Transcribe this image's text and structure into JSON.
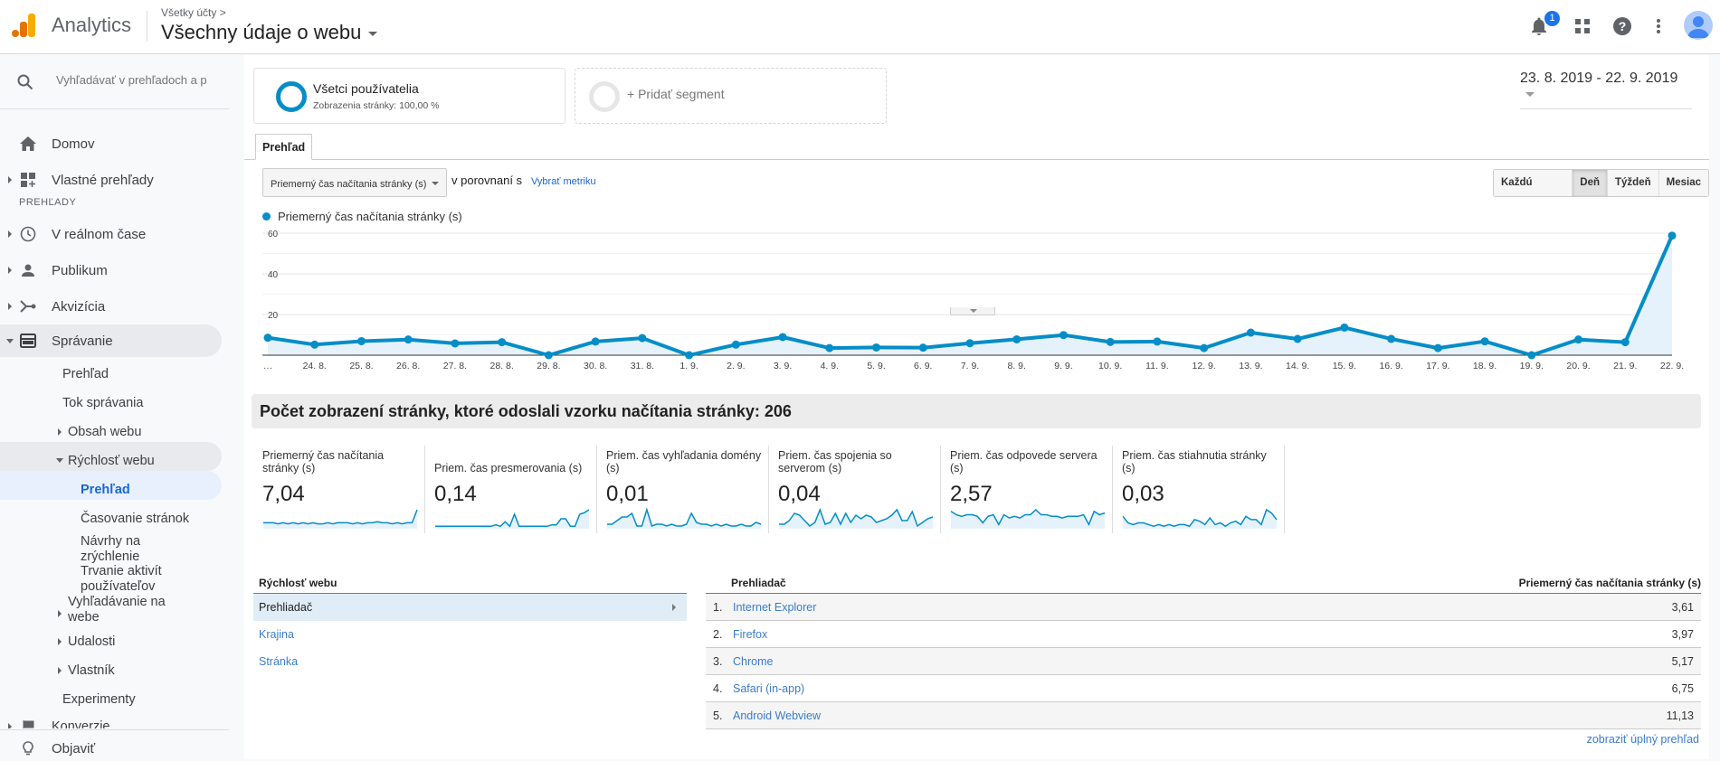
{
  "header": {
    "app_name": "Analytics",
    "breadcrumb": "Všetky účty >",
    "property": "Všechny údaje o webu",
    "notification_count": "1",
    "icons": [
      "bell-icon",
      "apps-grid-icon",
      "help-icon",
      "more-vert-icon",
      "account-avatar"
    ]
  },
  "sidebar": {
    "search_placeholder": "Vyhľadávať v prehľadoch a p",
    "items": [
      {
        "label": "Domov",
        "icon": "home-icon"
      },
      {
        "label": "Vlastné prehľady",
        "icon": "dashboard-add-icon"
      }
    ],
    "section_label": "PREHĽADY",
    "reports": [
      {
        "label": "V reálnom čase",
        "icon": "clock-icon"
      },
      {
        "label": "Publikum",
        "icon": "person-icon"
      },
      {
        "label": "Akvizícia",
        "icon": "acquisition-icon"
      },
      {
        "label": "Správanie",
        "icon": "behavior-icon"
      }
    ],
    "behavior_sub": {
      "overview": "Prehľad",
      "flow": "Tok správania",
      "content": "Obsah webu",
      "speed": "Rýchlosť webu",
      "speed_sub": [
        "Prehľad",
        "Časovanie stránok",
        "Návrhy na zrýchlenie"
      ],
      "user_timings": "Trvanie aktivít používateľov",
      "site_search": "Vyhľadávanie na webe",
      "events": "Udalosti",
      "publisher": "Vlastník",
      "experiments": "Experimenty"
    },
    "conversions": "Konverzie",
    "discover": "Objaviť"
  },
  "segments": {
    "active": {
      "title": "Všetci používatelia",
      "subtitle": "Zobrazenia stránky: 100,00 %"
    },
    "add_label": "+ Pridať segment"
  },
  "date_range": "23. 8. 2019 - 22. 9. 2019",
  "tabs": [
    "Prehľad"
  ],
  "controls": {
    "metric": "Priemerný čas načítania stránky (s)",
    "compare_text": "v porovnaní s",
    "compare_link": "Vybrať metriku",
    "granularity": [
      "Každú hodinu",
      "Deň",
      "Týždeň",
      "Mesiac"
    ],
    "active_granularity": "Deň"
  },
  "chart_data": {
    "type": "area",
    "title": "",
    "legend": [
      "Priemerný čas načítania stránky (s)"
    ],
    "series_color": "#058dc7",
    "x": [
      "…",
      "24. 8.",
      "25. 8.",
      "26. 8.",
      "27. 8.",
      "28. 8.",
      "29. 8.",
      "30. 8.",
      "31. 8.",
      "1. 9.",
      "2. 9.",
      "3. 9.",
      "4. 9.",
      "5. 9.",
      "6. 9.",
      "7. 9.",
      "8. 9.",
      "9. 9.",
      "10. 9.",
      "11. 9.",
      "12. 9.",
      "13. 9.",
      "14. 9.",
      "15. 9.",
      "16. 9.",
      "17. 9.",
      "18. 9.",
      "19. 9.",
      "20. 9.",
      "21. 9.",
      "22. 9."
    ],
    "series": [
      {
        "name": "Priemerný čas načítania stránky (s)",
        "values": [
          8.6,
          5.2,
          6.9,
          7.7,
          5.8,
          6.4,
          0,
          6.7,
          8.4,
          0,
          5.2,
          8.9,
          3.5,
          3.8,
          3.7,
          5.9,
          7.8,
          9.9,
          6.5,
          6.7,
          3.5,
          11.1,
          8.0,
          13.6,
          8.0,
          3.5,
          6.8,
          0,
          7.7,
          6.4,
          58.8
        ]
      }
    ],
    "yticks": [
      20,
      40,
      60
    ],
    "ylim": [
      0,
      60
    ],
    "grid": true,
    "legend_position": "top-left"
  },
  "summary": "Počet zobrazení stránky, ktoré odoslali vzorku načítania stránky: 206",
  "scorecards": [
    {
      "label": "Priemerný čas načítania stránky (s)",
      "value": "7,04",
      "spark": [
        5,
        5,
        5,
        4,
        5,
        4,
        5,
        4,
        5,
        4,
        5,
        4,
        4,
        5,
        4,
        5,
        5,
        5,
        4,
        5,
        4,
        5,
        5,
        6,
        5,
        5,
        4,
        5,
        4,
        5,
        5,
        18
      ]
    },
    {
      "label": "Priem. čas presmerovania (s)",
      "value": "0,14",
      "spark": [
        1,
        1,
        1,
        1,
        1,
        1,
        1,
        1,
        1,
        1,
        1,
        1,
        1,
        2,
        1,
        4,
        1,
        9,
        1,
        1,
        1,
        1,
        1,
        1,
        1,
        2,
        2,
        6,
        6,
        1,
        1,
        9,
        10,
        12
      ]
    },
    {
      "label": "Priem. čas vyhľadania domény (s)",
      "value": "0,01",
      "spark": [
        2,
        2,
        4,
        6,
        6,
        8,
        1,
        1,
        10,
        1,
        2,
        2,
        1,
        2,
        1,
        1,
        2,
        8,
        3,
        2,
        2,
        1,
        2,
        1,
        2,
        1,
        1,
        2,
        1,
        1,
        3,
        2
      ]
    },
    {
      "label": "Priem. čas spojenia so serverom (s)",
      "value": "0,04",
      "spark": [
        2,
        2,
        4,
        8,
        7,
        4,
        1,
        3,
        10,
        2,
        3,
        8,
        2,
        8,
        3,
        7,
        5,
        7,
        6,
        3,
        4,
        5,
        7,
        10,
        4,
        4,
        9,
        1,
        3,
        5,
        6
      ]
    },
    {
      "label": "Priem. čas odpovede servera (s)",
      "value": "2,57",
      "spark": [
        10,
        8,
        7,
        8,
        8,
        7,
        3,
        7,
        8,
        2,
        8,
        6,
        7,
        6,
        8,
        8,
        11,
        8,
        8,
        7,
        7,
        6,
        7,
        7,
        7,
        8,
        2,
        10,
        8,
        9
      ]
    },
    {
      "label": "Priem. čas stiahnutia stránky (s)",
      "value": "0,03",
      "spark": [
        7,
        3,
        2,
        3,
        3,
        2,
        1,
        2,
        1,
        2,
        1,
        2,
        2,
        1,
        5,
        4,
        2,
        6,
        2,
        3,
        1,
        3,
        4,
        2,
        7,
        5,
        5,
        2,
        11,
        9,
        5
      ]
    }
  ],
  "site_speed_list": {
    "header": "Rýchlosť webu",
    "items": [
      "Prehliadač",
      "Krajina",
      "Stránka"
    ],
    "active": "Prehliadač"
  },
  "browser_table": {
    "col_dimension": "Prehliadač",
    "col_metric": "Priemerný čas načítania stránky (s)",
    "rows": [
      {
        "idx": "1.",
        "name": "Internet Explorer",
        "value": "3,61"
      },
      {
        "idx": "2.",
        "name": "Firefox",
        "value": "3,97"
      },
      {
        "idx": "3.",
        "name": "Chrome",
        "value": "5,17"
      },
      {
        "idx": "4.",
        "name": "Safari (in-app)",
        "value": "6,75"
      },
      {
        "idx": "5.",
        "name": "Android Webview",
        "value": "11,13"
      }
    ],
    "full_report_link": "zobraziť úplný prehľad"
  }
}
